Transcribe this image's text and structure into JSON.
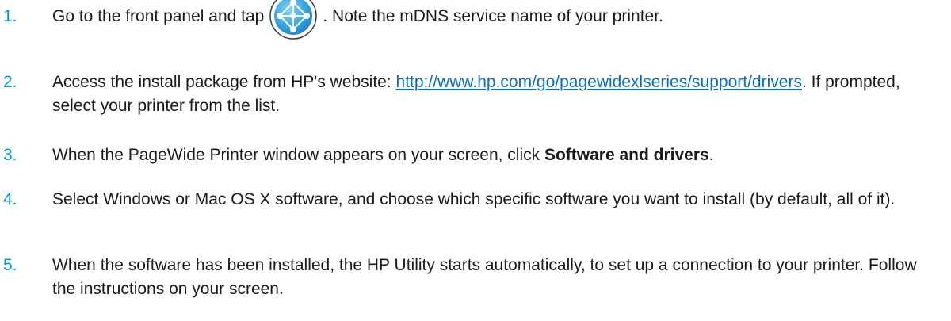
{
  "steps": [
    {
      "number": "1.",
      "text_before_icon": "Go to the front panel and tap",
      "icon": "network-globe-icon",
      "text_after_icon": ". Note the mDNS service name of your printer."
    },
    {
      "number": "2.",
      "text_before_link": "Access the install package from HP's website: ",
      "link": "http://www.hp.com/go/pagewidexlseries/support/drivers",
      "text_after_link": ". If prompted, select your printer from the list."
    },
    {
      "number": "3.",
      "text_before_bold": "When the PageWide Printer window appears on your screen, click ",
      "bold": "Software and drivers",
      "text_after_bold": "."
    },
    {
      "number": "4.",
      "text": "Select Windows or Mac OS X software, and choose which specific software you want to install (by default, all of it)."
    },
    {
      "number": "5.",
      "text": "When the software has been installed, the HP Utility starts automatically, to set up a connection to your printer. Follow the instructions on your screen."
    }
  ],
  "colors": {
    "step_number": "#0096d6",
    "link": "#0a6ebd",
    "text": "#1a1a1a"
  }
}
